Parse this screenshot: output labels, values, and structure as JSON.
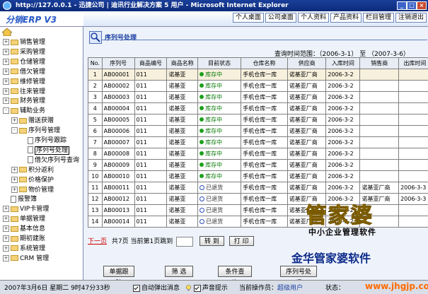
{
  "window": {
    "title": "http://127.0.0.1 - 迅捷公司 | 迪讯行业解决方案 5 用户 - Microsoft Internet Explorer"
  },
  "app": {
    "logo": "分销ERP V3"
  },
  "topnav": [
    "个人桌面",
    "公司桌面",
    "个人资料",
    "产品资料",
    "栏目管理",
    "注销退出"
  ],
  "sidebar": {
    "items": [
      {
        "label": "销售管理",
        "indent": 0,
        "expander": "+",
        "icon": "folder"
      },
      {
        "label": "采购管理",
        "indent": 0,
        "expander": "+",
        "icon": "folder"
      },
      {
        "label": "仓储管理",
        "indent": 0,
        "expander": "+",
        "icon": "folder"
      },
      {
        "label": "借欠管理",
        "indent": 0,
        "expander": "+",
        "icon": "folder"
      },
      {
        "label": "维修管理",
        "indent": 0,
        "expander": "+",
        "icon": "folder"
      },
      {
        "label": "往来管理",
        "indent": 0,
        "expander": "+",
        "icon": "folder"
      },
      {
        "label": "财务管理",
        "indent": 0,
        "expander": "+",
        "icon": "folder"
      },
      {
        "label": "辅助业务",
        "indent": 0,
        "expander": "-",
        "icon": "folder"
      },
      {
        "label": "赠送获赠",
        "indent": 1,
        "expander": "+",
        "icon": "folder"
      },
      {
        "label": "序列号管理",
        "indent": 1,
        "expander": "-",
        "icon": "folder"
      },
      {
        "label": "序列号跟踪",
        "indent": 2,
        "expander": "",
        "icon": "doc"
      },
      {
        "label": "序列号处理",
        "indent": 2,
        "expander": "",
        "icon": "doc",
        "selected": true
      },
      {
        "label": "借欠序列号查询",
        "indent": 2,
        "expander": "",
        "icon": "doc"
      },
      {
        "label": "积分返利",
        "indent": 1,
        "expander": "+",
        "icon": "folder"
      },
      {
        "label": "价格保护",
        "indent": 1,
        "expander": "+",
        "icon": "folder"
      },
      {
        "label": "物价管理",
        "indent": 1,
        "expander": "+",
        "icon": "folder"
      },
      {
        "label": "报警簿",
        "indent": 0,
        "expander": "",
        "icon": "doc"
      },
      {
        "label": "VIP卡管理",
        "indent": 0,
        "expander": "+",
        "icon": "folder"
      },
      {
        "label": "单据管理",
        "indent": 0,
        "expander": "+",
        "icon": "folder"
      },
      {
        "label": "基本信息",
        "indent": 0,
        "expander": "+",
        "icon": "folder"
      },
      {
        "label": "期初建账",
        "indent": 0,
        "expander": "+",
        "icon": "folder"
      },
      {
        "label": "系统管理",
        "indent": 0,
        "expander": "+",
        "icon": "folder"
      },
      {
        "label": "CRM 管理",
        "indent": 0,
        "expander": "+",
        "icon": "folder"
      }
    ]
  },
  "main": {
    "title": "序列号处理",
    "query_range": "查询时间范围：（2006-3-1） 至 （2007-3-6）",
    "columns": [
      "No.",
      "序列号",
      "商品编号",
      "商品名称",
      "目前状态",
      "仓库名称",
      "供应商",
      "入库时间",
      "销售商",
      "出库时间"
    ],
    "rows": [
      [
        "1",
        "AB00001",
        "011",
        "诺基亚",
        "库存中",
        "手机仓库一库",
        "诺基亚厂商",
        "2006-3-2",
        "",
        ""
      ],
      [
        "2",
        "AB00002",
        "011",
        "诺基亚",
        "库存中",
        "手机仓库一库",
        "诺基亚厂商",
        "2006-3-2",
        "",
        ""
      ],
      [
        "3",
        "AB00003",
        "011",
        "诺基亚",
        "库存中",
        "手机仓库一库",
        "诺基亚厂商",
        "2006-3-2",
        "",
        ""
      ],
      [
        "4",
        "AB00004",
        "011",
        "诺基亚",
        "库存中",
        "手机仓库一库",
        "诺基亚厂商",
        "2006-3-2",
        "",
        ""
      ],
      [
        "5",
        "AB00005",
        "011",
        "诺基亚",
        "库存中",
        "手机仓库一库",
        "诺基亚厂商",
        "2006-3-2",
        "",
        ""
      ],
      [
        "6",
        "AB00006",
        "011",
        "诺基亚",
        "库存中",
        "手机仓库一库",
        "诺基亚厂商",
        "2006-3-2",
        "",
        ""
      ],
      [
        "7",
        "AB00007",
        "011",
        "诺基亚",
        "库存中",
        "手机仓库一库",
        "诺基亚厂商",
        "2006-3-2",
        "",
        ""
      ],
      [
        "8",
        "AB00008",
        "011",
        "诺基亚",
        "库存中",
        "手机仓库一库",
        "诺基亚厂商",
        "2006-3-2",
        "",
        ""
      ],
      [
        "9",
        "AB00009",
        "011",
        "诺基亚",
        "库存中",
        "手机仓库一库",
        "诺基亚厂商",
        "2006-3-2",
        "",
        ""
      ],
      [
        "10",
        "AB00010",
        "011",
        "诺基亚",
        "库存中",
        "手机仓库一库",
        "诺基亚厂商",
        "2006-3-2",
        "",
        ""
      ],
      [
        "11",
        "AB00011",
        "011",
        "诺基亚",
        "已退货",
        "手机仓库一库",
        "诺基亚厂商",
        "2006-3-2",
        "诺基亚厂商",
        "2006-3-3"
      ],
      [
        "12",
        "AB00012",
        "011",
        "诺基亚",
        "已退货",
        "手机仓库一库",
        "诺基亚厂商",
        "2006-3-2",
        "诺基亚厂商",
        "2006-3-3"
      ],
      [
        "13",
        "AB00013",
        "011",
        "诺基亚",
        "已退货",
        "手机仓库一库",
        "诺基亚厂商",
        "2006-3-2",
        "",
        ""
      ],
      [
        "14",
        "AB00014",
        "011",
        "诺基亚",
        "已退货",
        "手机仓库一库",
        "诺基亚厂商",
        "2006-3-2",
        "",
        ""
      ]
    ],
    "selected_row": 0,
    "pager": {
      "next_label": "下一页",
      "summary": "共7页  当前第1页跳到",
      "goto_label": "转 到",
      "print_label": "打 印"
    },
    "buttons": [
      "单据跟踪",
      "筛 选",
      "条件查询",
      "序列号处理"
    ]
  },
  "status": {
    "datetime": "2007年3月6日 星期二 9时47分33秒",
    "popup_label": "自动弹出消息",
    "sound_label": "声音提示",
    "operator_prefix": "当前操作员：",
    "operator": "超级用户",
    "state_label": "状态："
  },
  "watermark": {
    "big": "管家婆",
    "sub": "中小企业管理软件",
    "brand": "金华管家婆软件",
    "url": "www.jhgjp.com"
  },
  "colors": {
    "in_stock": "#0a7a0a",
    "returned_dot": "#2a4db8",
    "title": "#1a3fa0"
  }
}
